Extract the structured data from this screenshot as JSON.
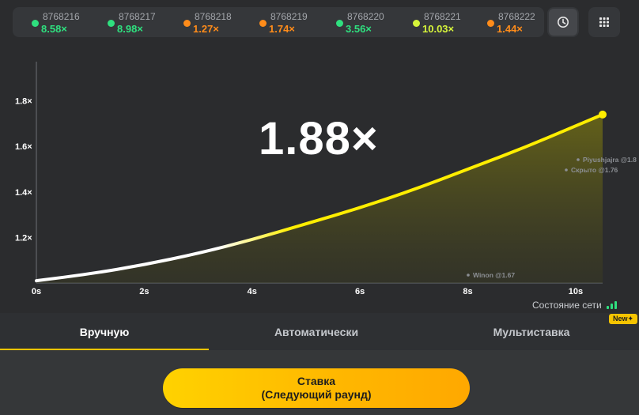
{
  "history": [
    {
      "round": "8768216",
      "multiplier": "8.58×",
      "color": "#2fe07f"
    },
    {
      "round": "8768217",
      "multiplier": "8.98×",
      "color": "#2fe07f"
    },
    {
      "round": "8768218",
      "multiplier": "1.27×",
      "color": "#ff8c1a"
    },
    {
      "round": "8768219",
      "multiplier": "1.74×",
      "color": "#ff8c1a"
    },
    {
      "round": "8768220",
      "multiplier": "3.56×",
      "color": "#2fe07f"
    },
    {
      "round": "8768221",
      "multiplier": "10.03×",
      "color": "#d7f53a"
    },
    {
      "round": "8768222",
      "multiplier": "1.44×",
      "color": "#ff8c1a"
    }
  ],
  "header_buttons": {
    "history_icon": "clock-icon",
    "menu_icon": "grid-icon"
  },
  "game": {
    "current_multiplier": "1.88×"
  },
  "chart_data": {
    "type": "line",
    "x_ticks": [
      "0s",
      "2s",
      "4s",
      "6s",
      "8s",
      "10s"
    ],
    "y_ticks": [
      "1.2×",
      "1.4×",
      "1.6×",
      "1.8×"
    ],
    "xlim": [
      0,
      10.5
    ],
    "ylim": [
      1.0,
      2.0
    ],
    "series": [
      {
        "points": [
          [
            0,
            1.01
          ],
          [
            1,
            1.04
          ],
          [
            2,
            1.08
          ],
          [
            3,
            1.13
          ],
          [
            4,
            1.19
          ],
          [
            5,
            1.26
          ],
          [
            6,
            1.33
          ],
          [
            7,
            1.41
          ],
          [
            8,
            1.5
          ],
          [
            9,
            1.59
          ],
          [
            10,
            1.69
          ],
          [
            10.5,
            1.74
          ]
        ]
      }
    ],
    "cashouts": [
      {
        "label": "Piyushjajra @1.8",
        "x": 10.2,
        "y": 1.69
      },
      {
        "label": "Скрыто @1.76",
        "x": 9.9,
        "y": 1.62
      },
      {
        "label": "Winon @1.67",
        "x": 8.0,
        "y": 1.03
      }
    ],
    "colors": {
      "line": "#ffee00",
      "start": "#ffffff",
      "fill": "#5b5a16"
    }
  },
  "network": {
    "label": "Состояние сети"
  },
  "badge": {
    "new": "New✦"
  },
  "tabs": [
    {
      "label": "Вручную",
      "active": true
    },
    {
      "label": "Автоматически",
      "active": false
    },
    {
      "label": "Мультиставка",
      "active": false
    }
  ],
  "bet": {
    "line1": "Ставка",
    "line2": "(Следующий раунд)"
  },
  "colors": {
    "accent": "#f5c400",
    "background": "#2b2c2e"
  }
}
